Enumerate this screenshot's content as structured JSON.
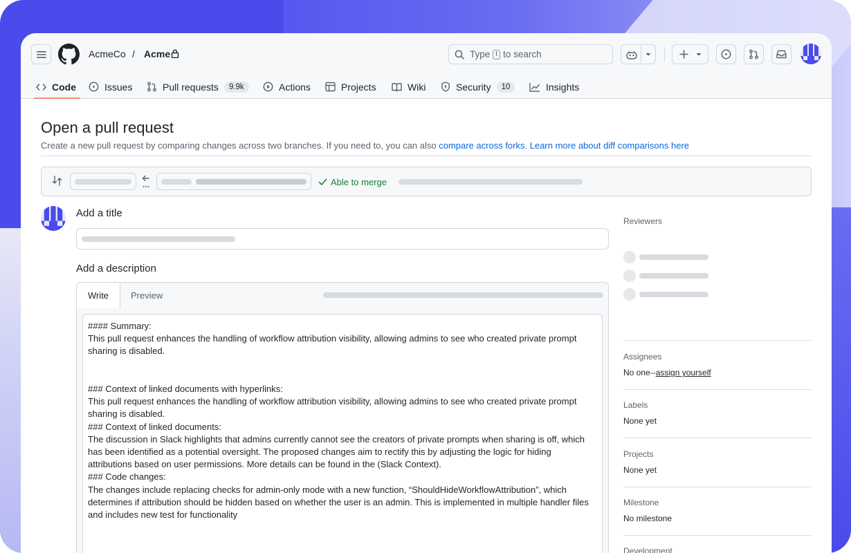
{
  "header": {
    "org": "AcmeCo",
    "separator": "/",
    "repo": "Acme",
    "search": {
      "prefix": "Type",
      "key": "t",
      "suffix": "to search"
    },
    "icons": [
      "hamburger-icon",
      "github-logo-icon",
      "lock-icon",
      "search-icon",
      "copilot-icon",
      "chevron-down-icon",
      "plus-icon",
      "issue-icon",
      "pull-request-icon",
      "inbox-icon",
      "avatar"
    ]
  },
  "nav": {
    "code": "Code",
    "issues": "Issues",
    "pull_requests": "Pull requests",
    "pull_requests_count": "9.9k",
    "actions": "Actions",
    "projects": "Projects",
    "wiki": "Wiki",
    "security": "Security",
    "security_count": "10",
    "insights": "Insights"
  },
  "page": {
    "title": "Open a pull request",
    "subtitle": "Create a new pull request by comparing changes across two branches. If you need to, you can also",
    "link1": "compare across forks.",
    "link2": "Learn more about diff comparisons here"
  },
  "compare": {
    "status": "Able to merge"
  },
  "form": {
    "title_label": "Add a title",
    "description_label": "Add a description",
    "tab_write": "Write",
    "tab_preview": "Preview",
    "body": "#### Summary:\nThis pull request enhances the handling of workflow attribution visibility, allowing admins to see who created private prompt sharing is disabled.\n\n\n### Context of linked documents with hyperlinks:\nThis pull request enhances the handling of workflow attribution visibility, allowing admins to see who created private prompt sharing is disabled.\n### Context of linked documents:\nThe discussion in Slack highlights that admins currently cannot see the creators of private prompts when sharing is off, which has been identified as a potential oversight. The proposed changes aim to rectify this by adjusting the logic for hiding attributions based on user permissions. More details can be found in the (Slack Context).\n### Code changes:\nThe changes include replacing checks for admin-only mode with a new function, “ShouldHideWorkflowAttribution”, which determines if attribution should be hidden based on whether the user is an admin. This is implemented in multiple handler files and includes new test for functionality"
  },
  "sidebar": {
    "reviewers": "Reviewers",
    "assignees": "Assignees",
    "assignees_value": "No one--",
    "assign_yourself": "assign yourself",
    "labels": "Labels",
    "labels_value": "None yet",
    "projects": "Projects",
    "projects_value": "None yet",
    "milestone": "Milestone",
    "milestone_value": "No milestone",
    "development": "Development"
  },
  "colors": {
    "accent_underline": "#fd8c73",
    "link": "#0969da",
    "merge_green": "#1a7f37",
    "background_purple": "#4a4bea"
  }
}
